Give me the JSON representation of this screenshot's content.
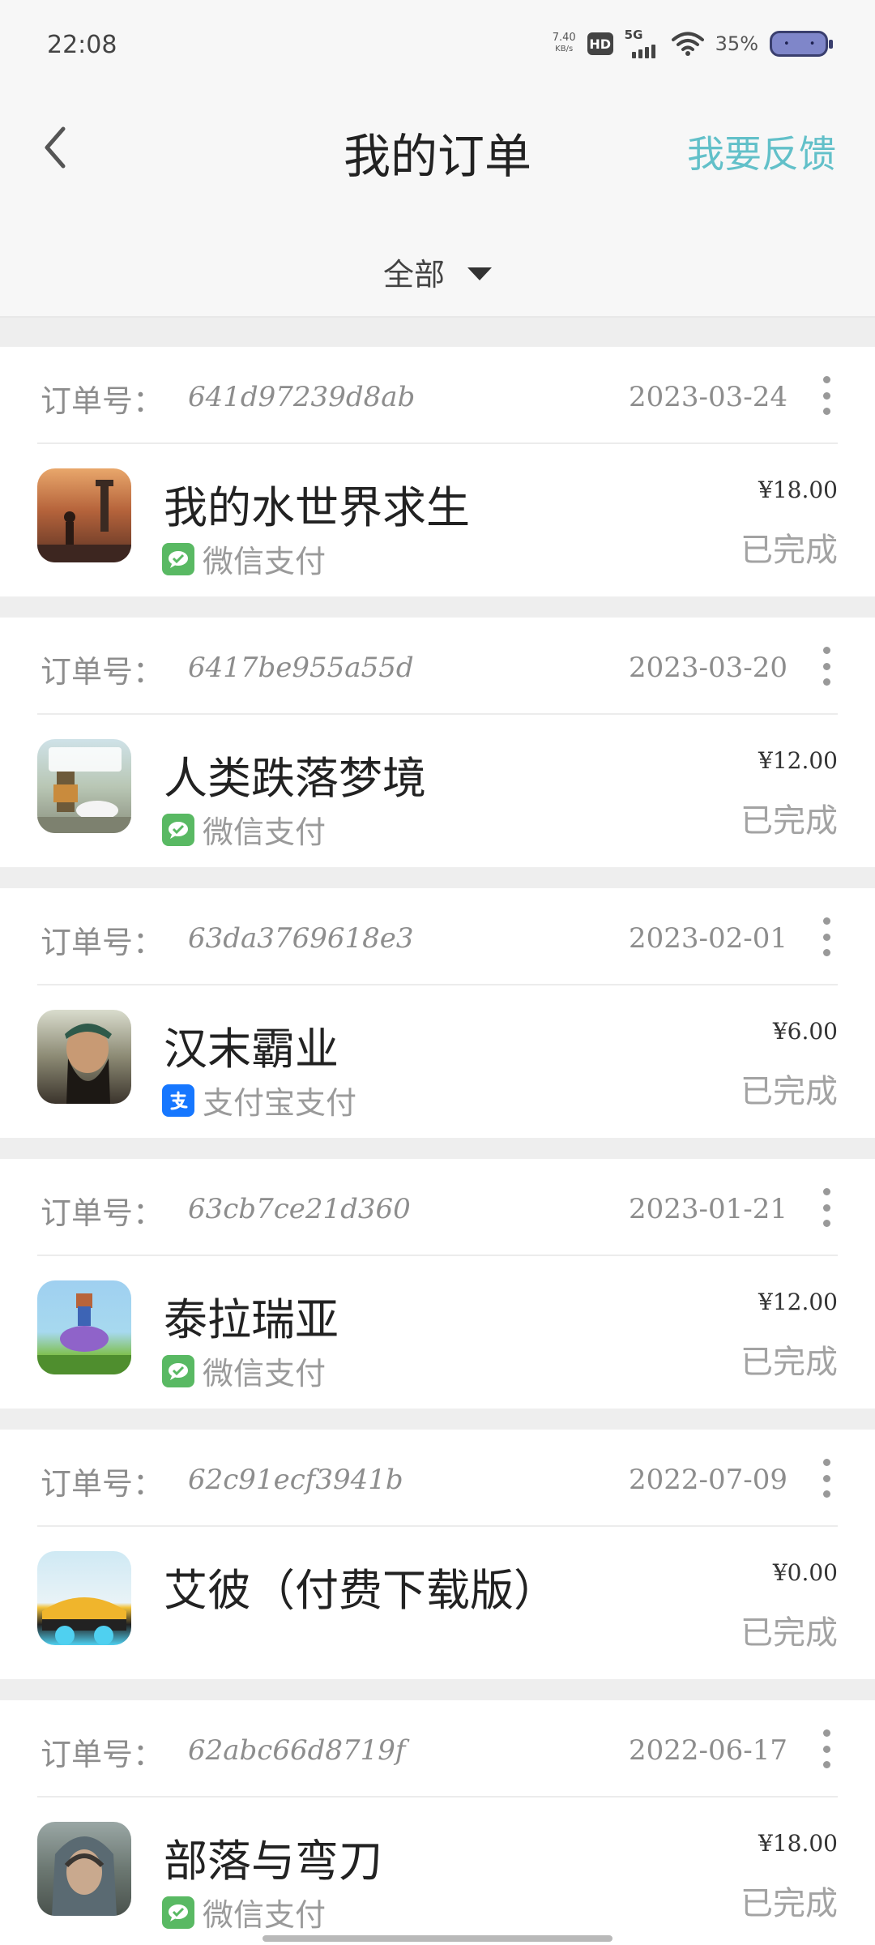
{
  "status_bar": {
    "time": "22:08",
    "net_speed_value": "7.40",
    "net_speed_unit": "KB/s",
    "hd_badge": "HD",
    "network": "5G",
    "battery_percent": "35%",
    "icons": [
      "hd-badge",
      "signal-5g-icon",
      "wifi-icon",
      "battery-icon"
    ]
  },
  "header": {
    "title": "我的订单",
    "feedback_label": "我要反馈",
    "back_icon": "chevron-left-icon"
  },
  "filter": {
    "selected": "全部",
    "icon": "caret-down-icon"
  },
  "order_no_label": "订单号：",
  "orders": [
    {
      "order_no": "641d97239d8ab",
      "date": "2023-03-24",
      "name": "我的水世界求生",
      "pay_method": "微信支付",
      "pay_icon": "wechat-pay-icon",
      "price": "¥18.00",
      "status": "已完成"
    },
    {
      "order_no": "6417be955a55d",
      "date": "2023-03-20",
      "name": "人类跌落梦境",
      "pay_method": "微信支付",
      "pay_icon": "wechat-pay-icon",
      "price": "¥12.00",
      "status": "已完成"
    },
    {
      "order_no": "63da3769618e3",
      "date": "2023-02-01",
      "name": "汉末霸业",
      "pay_method": "支付宝支付",
      "pay_icon": "alipay-icon",
      "price": "¥6.00",
      "status": "已完成"
    },
    {
      "order_no": "63cb7ce21d360",
      "date": "2023-01-21",
      "name": "泰拉瑞亚",
      "pay_method": "微信支付",
      "pay_icon": "wechat-pay-icon",
      "price": "¥12.00",
      "status": "已完成"
    },
    {
      "order_no": "62c91ecf3941b",
      "date": "2022-07-09",
      "name": "艾彼（付费下载版）",
      "pay_method": "",
      "pay_icon": "",
      "price": "¥0.00",
      "status": "已完成"
    },
    {
      "order_no": "62abc66d8719f",
      "date": "2022-06-17",
      "name": "部落与弯刀",
      "pay_method": "微信支付",
      "pay_icon": "wechat-pay-icon",
      "price": "¥18.00",
      "status": "已完成"
    }
  ],
  "colors": {
    "accent": "#62c0c9",
    "wechat": "#59b963",
    "alipay": "#1677ff",
    "page_bg": "#eeeeee",
    "card_bg": "#ffffff"
  }
}
